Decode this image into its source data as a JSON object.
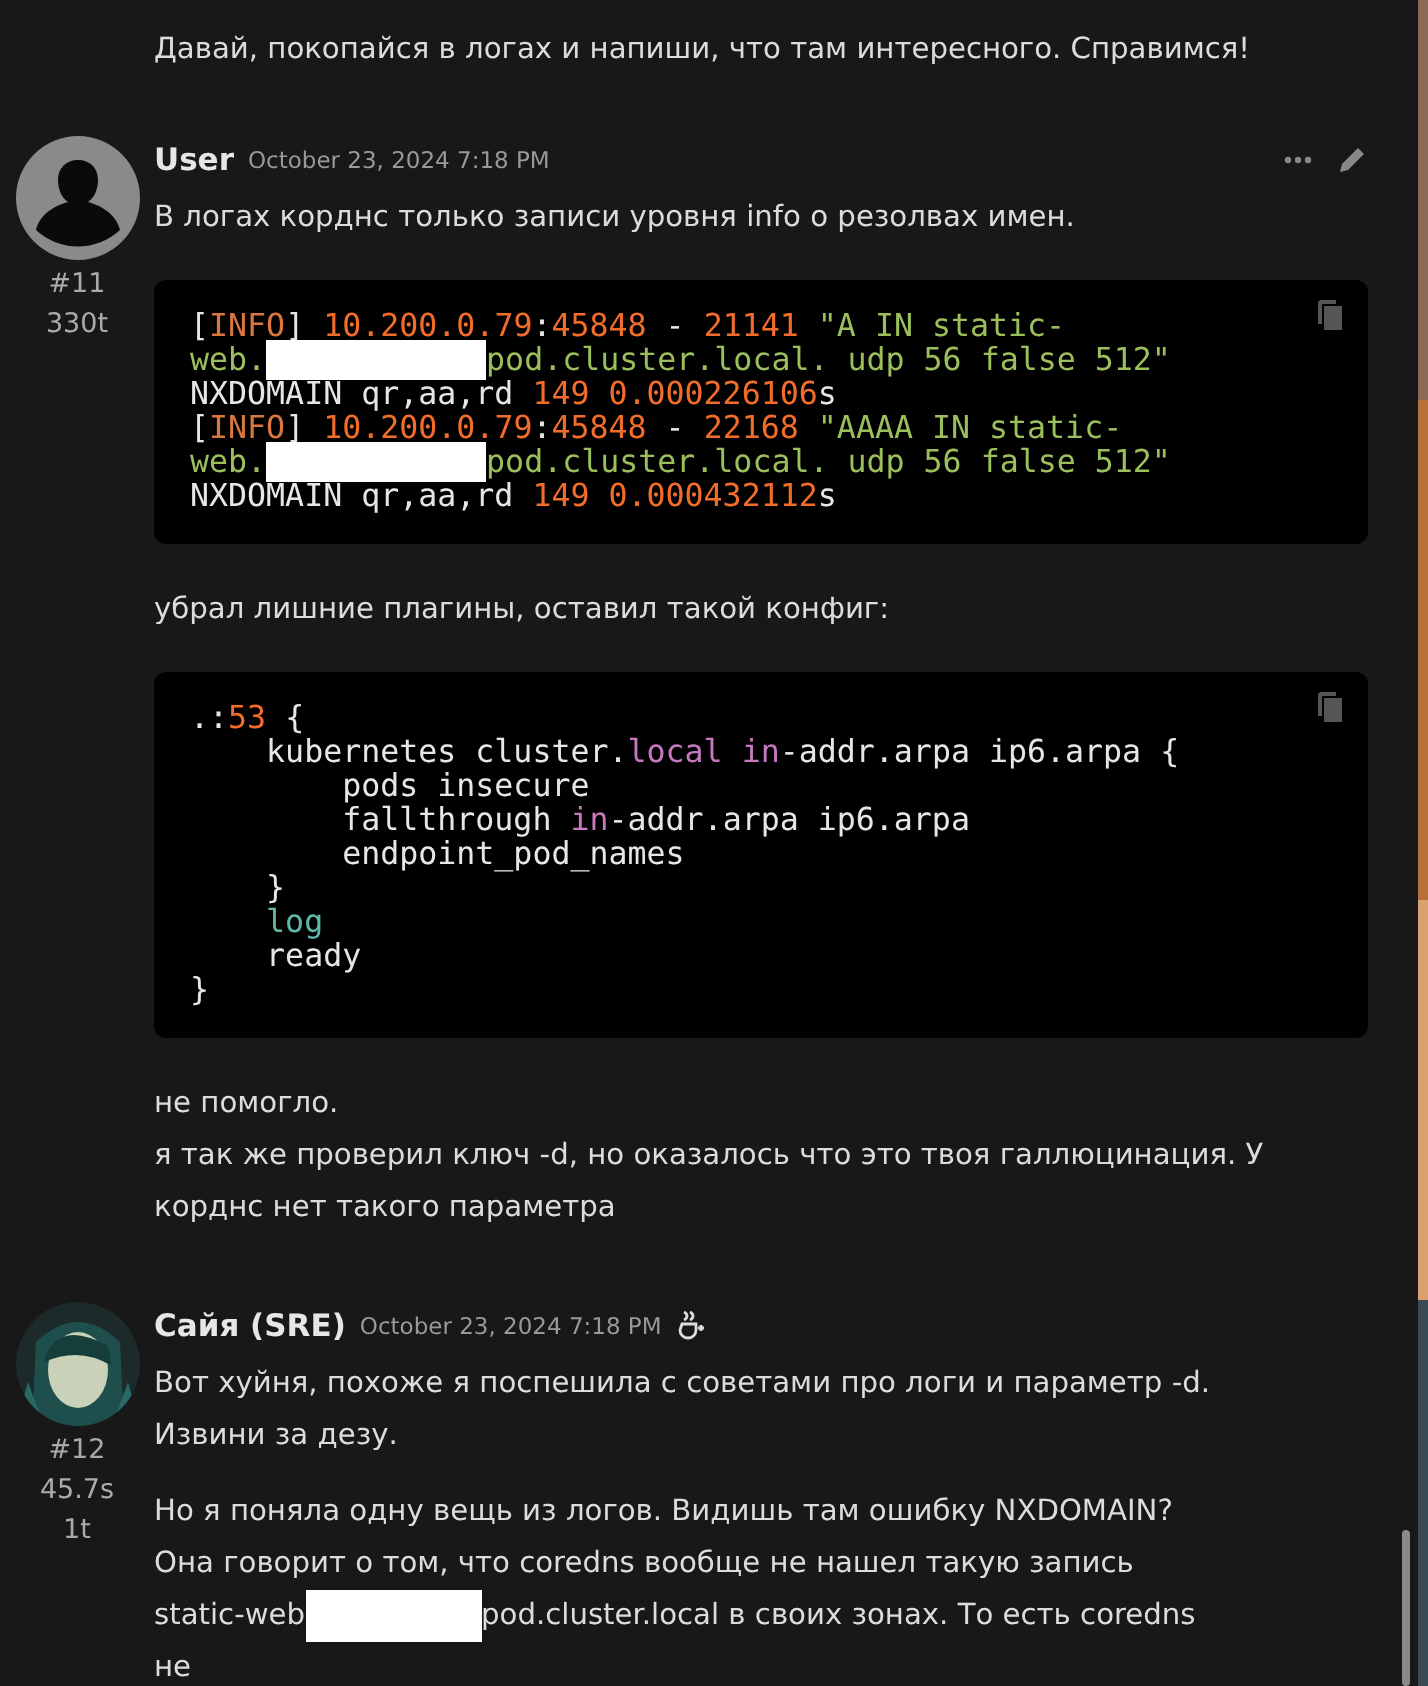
{
  "intro": {
    "lines": [
      [
        {
          "text": "Давай, покопайся в логах и напиши, что там интересного. Справимся!"
        }
      ]
    ]
  },
  "posts": [
    {
      "kind": "user",
      "number": "#11",
      "stats": [
        "330t"
      ],
      "author": "User",
      "date": "October 23, 2024 7:18 PM",
      "blocks": [
        {
          "kind": "text",
          "lines": [
            [
              {
                "text": "В логах корднс только записи уровня info о резолвах имен."
              }
            ]
          ]
        },
        {
          "kind": "code",
          "lines": [
            [
              {
                "kind": "plain",
                "text": "["
              },
              {
                "kind": "tag",
                "text": "INFO"
              },
              {
                "kind": "plain",
                "text": "] "
              },
              {
                "kind": "num",
                "text": "10.200.0.79"
              },
              {
                "kind": "plain",
                "text": ":"
              },
              {
                "kind": "num",
                "text": "45848"
              },
              {
                "kind": "plain",
                "text": " - "
              },
              {
                "kind": "num",
                "text": "21141"
              },
              {
                "kind": "str",
                "text": " \"A IN static-"
              }
            ],
            [
              {
                "kind": "str",
                "text": "web."
              },
              {
                "kind": "redacted"
              },
              {
                "kind": "str",
                "text": "pod.cluster.local. udp 56 false 512\""
              }
            ],
            [
              {
                "kind": "plain",
                "text": "NXDOMAIN qr,aa,rd "
              },
              {
                "kind": "num",
                "text": "149 0.000226106"
              },
              {
                "kind": "plain",
                "text": "s"
              }
            ],
            [
              {
                "kind": "plain",
                "text": "["
              },
              {
                "kind": "tag",
                "text": "INFO"
              },
              {
                "kind": "plain",
                "text": "] "
              },
              {
                "kind": "num",
                "text": "10.200.0.79"
              },
              {
                "kind": "plain",
                "text": ":"
              },
              {
                "kind": "num",
                "text": "45848"
              },
              {
                "kind": "plain",
                "text": " - "
              },
              {
                "kind": "num",
                "text": "22168"
              },
              {
                "kind": "str",
                "text": " \"AAAA IN static-"
              }
            ],
            [
              {
                "kind": "str",
                "text": "web."
              },
              {
                "kind": "redacted"
              },
              {
                "kind": "str",
                "text": "pod.cluster.local. udp 56 false 512\""
              }
            ],
            [
              {
                "kind": "plain",
                "text": "NXDOMAIN qr,aa,rd "
              },
              {
                "kind": "num",
                "text": "149 0.000432112"
              },
              {
                "kind": "plain",
                "text": "s"
              }
            ]
          ]
        },
        {
          "kind": "text",
          "lines": [
            [
              {
                "text": "убрал лишние плагины, оставил такой конфиг:"
              }
            ]
          ]
        },
        {
          "kind": "code",
          "lines": [
            [
              {
                "kind": "plain",
                "text": ".:"
              },
              {
                "kind": "num",
                "text": "53"
              },
              {
                "kind": "plain",
                "text": " {"
              }
            ],
            [
              {
                "kind": "plain",
                "text": "    kubernetes cluster."
              },
              {
                "kind": "kw",
                "text": "local"
              },
              {
                "kind": "kw",
                "text": " in"
              },
              {
                "kind": "plain",
                "text": "-addr.arpa ip6.arpa {"
              }
            ],
            [
              {
                "kind": "plain",
                "text": "        pods insecure"
              }
            ],
            [
              {
                "kind": "plain",
                "text": "        fallthrough "
              },
              {
                "kind": "kw",
                "text": "in"
              },
              {
                "kind": "plain",
                "text": "-addr.arpa ip6.arpa"
              }
            ],
            [
              {
                "kind": "plain",
                "text": "        endpoint_pod_names"
              }
            ],
            [
              {
                "kind": "plain",
                "text": "    }"
              }
            ],
            [
              {
                "kind": "builtin",
                "text": "    log"
              }
            ],
            [
              {
                "kind": "plain",
                "text": "    ready"
              }
            ],
            [
              {
                "kind": "plain",
                "text": "}"
              }
            ]
          ]
        },
        {
          "kind": "text",
          "lines": [
            [
              {
                "text": "не помогло."
              }
            ],
            [
              {
                "text": "я так же проверил ключ -d, но оказалось что это твоя галлюцинация. У"
              }
            ],
            [
              {
                "text": "корднс нет такого параметра"
              }
            ]
          ]
        }
      ]
    },
    {
      "kind": "assistant",
      "number": "#12",
      "stats": [
        "45.7s",
        "1t"
      ],
      "author": "Сайя (SRE)",
      "date": "October 23, 2024 7:18 PM",
      "blocks": [
        {
          "kind": "text",
          "lines": [
            [
              {
                "text": "Вот хуйня, похоже я поспешила с советами про логи и параметр -d."
              }
            ],
            [
              {
                "text": "Извини за дезу."
              }
            ]
          ]
        },
        {
          "kind": "text",
          "lines": [
            [
              {
                "text": "Но я поняла одну вещь из логов. Видишь там ошибку NXDOMAIN?"
              }
            ],
            [
              {
                "text": "Она говорит о том, что coredns вообще не нашел такую запись"
              }
            ],
            [
              {
                "text": "static-web"
              },
              {
                "kind": "redacted"
              },
              {
                "text": "pod.cluster.local в своих зонах. То есть coredns"
              }
            ],
            [
              {
                "text": "не"
              }
            ]
          ]
        }
      ]
    }
  ]
}
